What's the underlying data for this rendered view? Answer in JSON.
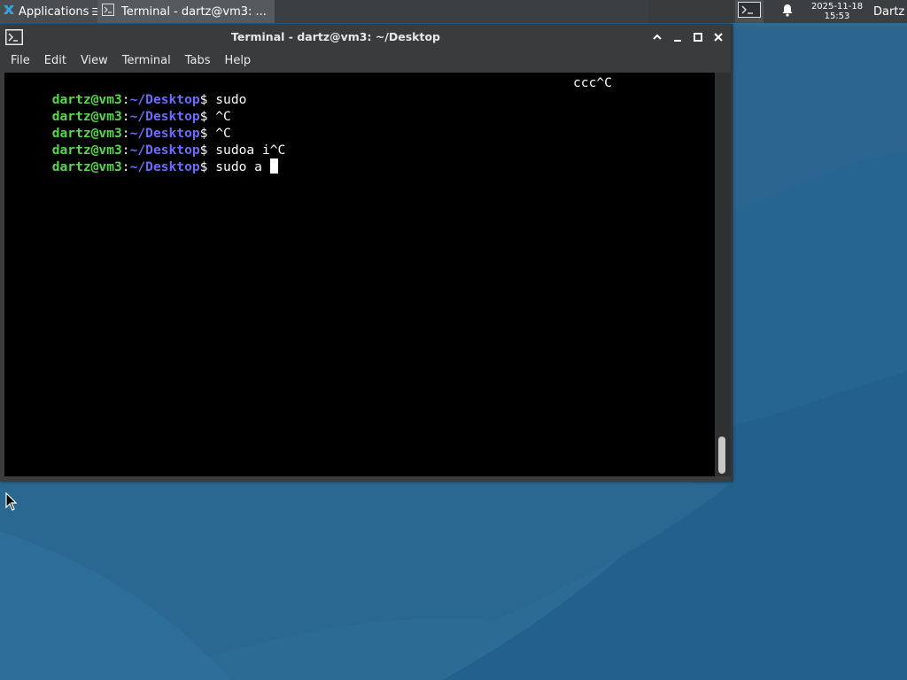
{
  "panel": {
    "applications_label": "Applications",
    "task_label": "Terminal - dartz@vm3: ...",
    "clock_date": "2025-11-18",
    "clock_time": "15:53",
    "user": "Dartz",
    "icons": [
      "xfce-logo-icon",
      "terminal-icon",
      "bell-icon"
    ]
  },
  "window": {
    "title": "Terminal - dartz@vm3: ~/Desktop",
    "menu": [
      "File",
      "Edit",
      "View",
      "Terminal",
      "Tabs",
      "Help"
    ]
  },
  "terminal": {
    "prompt_user": "dartz@vm3",
    "prompt_colon": ":",
    "prompt_path": "~/Desktop",
    "prompt_dollar": "$",
    "lines": [
      {
        "command": " sudo",
        "right": "ccc^C"
      },
      {
        "command": " ^C"
      },
      {
        "command": " ^C"
      },
      {
        "command": " sudoa i^C"
      },
      {
        "command": " sudo a "
      }
    ]
  },
  "colors": {
    "prompt_user": "#55d94a",
    "prompt_path": "#6b6bff",
    "terminal_bg": "#000000",
    "desktop_bg": "#2a6a92"
  }
}
